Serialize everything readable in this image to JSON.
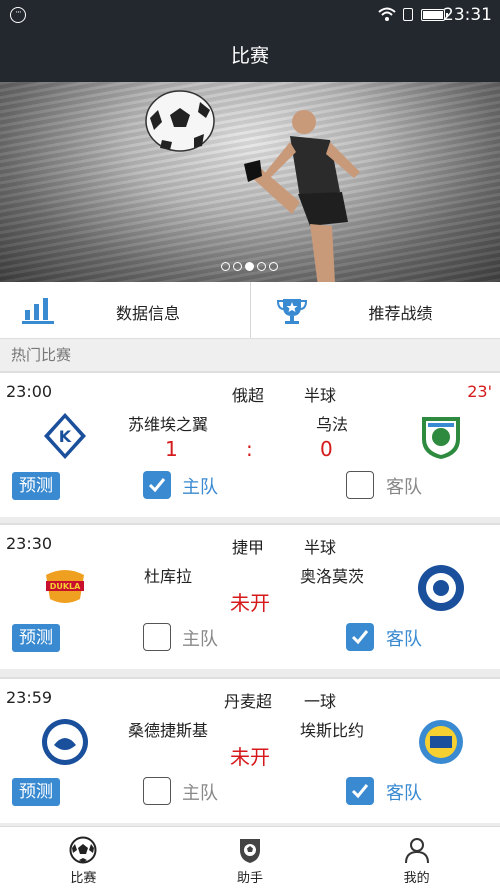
{
  "status_bar": {
    "time": "23:31"
  },
  "header": {
    "title": "比赛"
  },
  "banner": {
    "dots": 5,
    "active_dot": 3
  },
  "quick_links": [
    {
      "label": "数据信息",
      "icon": "bar-chart-icon"
    },
    {
      "label": "推荐战绩",
      "icon": "trophy-icon"
    }
  ],
  "section": {
    "title": "热门比赛"
  },
  "matches": [
    {
      "time": "23:00",
      "league": "俄超",
      "status": "半球",
      "minute": "23'",
      "home": "苏维埃之翼",
      "away": "乌法",
      "score_home": "1",
      "score_sep": ":",
      "score_away": "0",
      "predict": "预测",
      "home_label": "主队",
      "away_label": "客队",
      "home_checked": true,
      "away_checked": false
    },
    {
      "time": "23:30",
      "league": "捷甲",
      "status": "半球",
      "home": "杜库拉",
      "away": "奥洛莫茨",
      "result_text": "未开",
      "predict": "预测",
      "home_label": "主队",
      "away_label": "客队",
      "home_checked": false,
      "away_checked": true
    },
    {
      "time": "23:59",
      "league": "丹麦超",
      "status": "一球",
      "home": "桑德捷斯基",
      "away": "埃斯比约",
      "result_text": "未开",
      "predict": "预测",
      "home_label": "主队",
      "away_label": "客队",
      "home_checked": false,
      "away_checked": true
    }
  ],
  "tabs": [
    {
      "label": "比赛",
      "icon": "soccer-ball-icon"
    },
    {
      "label": "助手",
      "icon": "shield-ball-icon"
    },
    {
      "label": "我的",
      "icon": "person-icon"
    }
  ],
  "colors": {
    "accent": "#3a8ad1",
    "score": "#d6191b",
    "header": "#23272e"
  }
}
